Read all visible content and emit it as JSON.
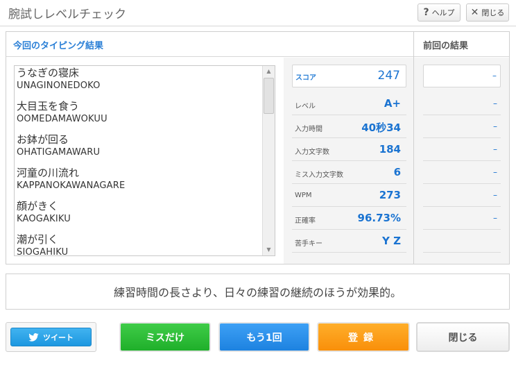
{
  "header": {
    "title": "腕試しレベルチェック",
    "help_icon": "?",
    "help_label": "ヘルプ",
    "close_icon": "✕",
    "close_label": "閉じる"
  },
  "panel": {
    "current_title": "今回のタイピング結果",
    "previous_title": "前回の結果"
  },
  "words": [
    {
      "jp": "うなぎの寝床",
      "romaji": "UNAGINONEDOKO"
    },
    {
      "jp": "大目玉を食う",
      "romaji": "OOMEDAMAWOKUU"
    },
    {
      "jp": "お鉢が回る",
      "romaji": "OHATIGAMAWARU"
    },
    {
      "jp": "河童の川流れ",
      "romaji": "KAPPANOKAWANAGARE"
    },
    {
      "jp": "顔がきく",
      "romaji": "KAOGAKIKU"
    },
    {
      "jp": "潮が引く",
      "romaji": "SIOGAHIKU"
    }
  ],
  "stats": [
    {
      "label": "スコア",
      "value": "247",
      "prev": "–"
    },
    {
      "label": "レベル",
      "value": "A+",
      "prev": "–"
    },
    {
      "label": "入力時間",
      "value": "40秒34",
      "prev": "–"
    },
    {
      "label": "入力文字数",
      "value": "184",
      "prev": "–"
    },
    {
      "label": "ミス入力文字数",
      "value": "6",
      "prev": "–"
    },
    {
      "label": "WPM",
      "value": "273",
      "prev": "–"
    },
    {
      "label": "正確率",
      "value": "96.73%",
      "prev": "–"
    },
    {
      "label": "苦手キー",
      "value": "Y Z",
      "prev": ""
    }
  ],
  "message": "練習時間の長さより、日々の練習の継続のほうが効果的。",
  "buttons": {
    "tweet": "ツイート",
    "miss_only": "ミスだけ",
    "again": "もう1回",
    "register": "登録",
    "close": "閉じる"
  },
  "colors": {
    "accent_blue": "#1a73d1",
    "tweet": "#1d97e0",
    "green": "#1faf2a",
    "blue": "#1d82e0",
    "orange": "#f98f0a"
  },
  "icons": {
    "tweet": "twitter-bird-icon",
    "help": "question-icon",
    "close": "close-x-icon"
  }
}
